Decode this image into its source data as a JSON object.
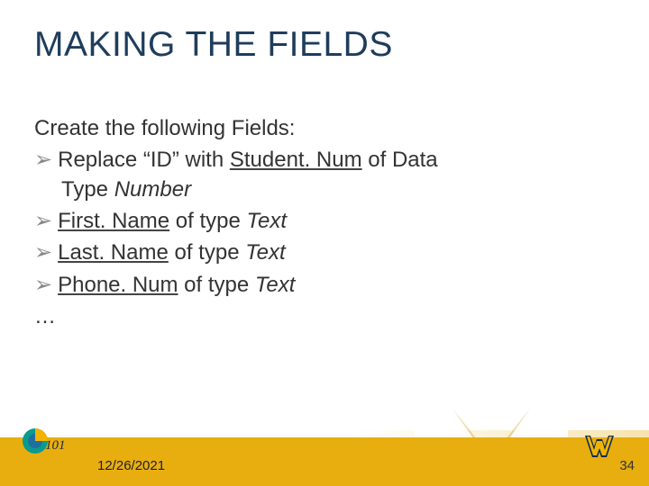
{
  "title": "MAKING THE FIELDS",
  "intro": "Create the following Fields:",
  "bullets": [
    {
      "pre": "Replace “ID” with ",
      "field": "Student. Num",
      "mid": " of Data",
      "wrap": "Type ",
      "type": "Number"
    },
    {
      "field": "First. Name",
      "mid": " of type ",
      "type": "Text"
    },
    {
      "field": "Last. Name",
      "mid": " of type ",
      "type": "Text"
    },
    {
      "field": "Phone. Num",
      "mid": " of type ",
      "type": "Text"
    }
  ],
  "ellipsis": "…",
  "bullet_glyph": "➢",
  "footer": {
    "date": "12/26/2021",
    "page": "34"
  },
  "logos": {
    "left": "cs101-logo",
    "right": "wv-logo"
  },
  "colors": {
    "title": "#1f3d5b",
    "gold": "#e8ae10",
    "wv_blue": "#0d2b52",
    "wv_gold": "#f1b500"
  }
}
